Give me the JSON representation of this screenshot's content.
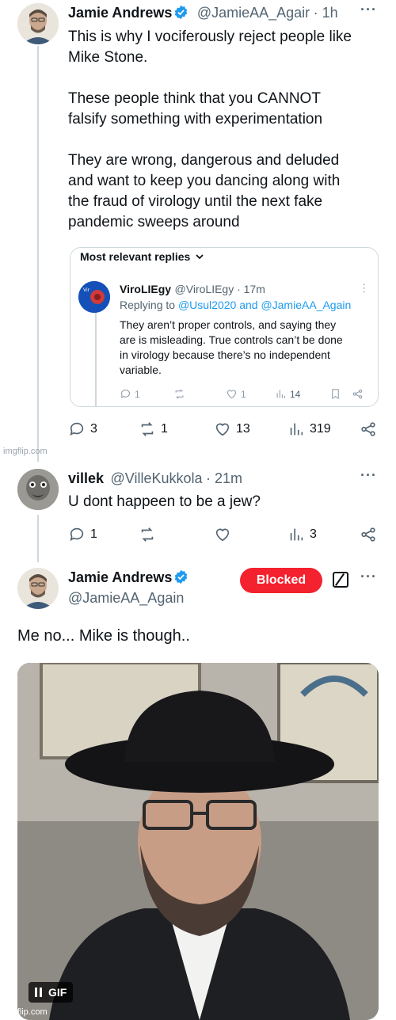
{
  "tweet1": {
    "name": "Jamie Andrews",
    "handle": "@JamieAA_Agair",
    "time": "· 1h",
    "text": "This is why I vociferously reject people like\nMike Stone.\n\nThese people think that you CANNOT\nfalsify something with experimentation\n\nThey are wrong, dangerous and deluded\nand want to keep you dancing along with\nthe  fraud of virology until the next fake\npandemic sweeps around",
    "actions": {
      "replies": "3",
      "reposts": "1",
      "likes": "13",
      "views": "319"
    }
  },
  "quote": {
    "header": "Most relevant replies",
    "name": "ViroLIEgy",
    "handle": "@ViroLIEgy · 17m",
    "replying_prefix": "Replying to",
    "replying_to": "@Usul2020 and @JamieAA_Again",
    "text": "They aren’t proper controls, and saying they\nare is misleading. True controls can’t be done\nin virology because there’s no independent\nvariable.",
    "actions": {
      "replies": "1",
      "likes": "1",
      "views": "14"
    }
  },
  "tweet2": {
    "name": "villek",
    "handle": "@VilleKukkola",
    "time": "· 21m",
    "text": "U dont happeen to be a jew?",
    "actions": {
      "replies": "1",
      "views": "3"
    }
  },
  "tweet3": {
    "name": "Jamie Andrews",
    "handle": "@JamieAA_Again",
    "blocked_label": "Blocked",
    "text": "Me no... Mike is though..",
    "gif_label": "GIF"
  },
  "watermarks": {
    "top": "imgflip.com",
    "bottom": "imgflip.com"
  },
  "colors": {
    "accent": "#1d9bf0",
    "blocked": "#f4212e",
    "verified": "#1d9bf0"
  }
}
